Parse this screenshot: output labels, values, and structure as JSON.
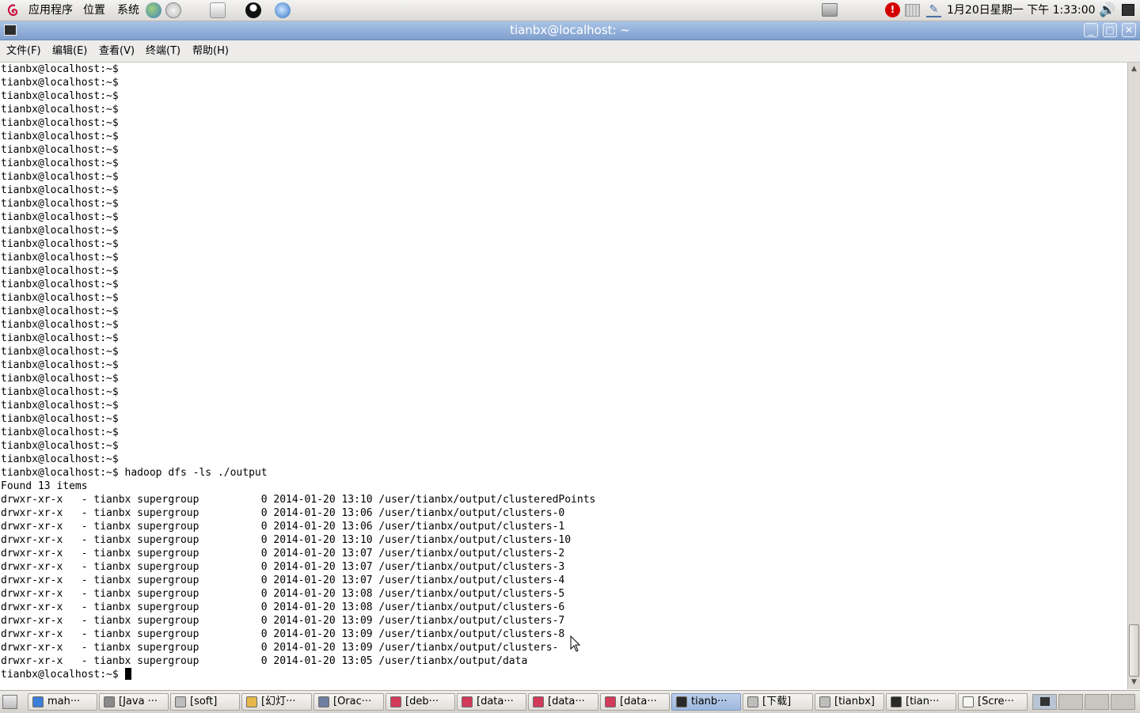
{
  "top_panel": {
    "applications": "应用程序",
    "places": "位置",
    "system": "系统",
    "clock": "1月20日星期一 下午  1:33:00"
  },
  "window": {
    "title": "tianbx@localhost: ~",
    "menus": [
      "文件(F)",
      "编辑(E)",
      "查看(V)",
      "终端(T)",
      "帮助(H)"
    ]
  },
  "terminal": {
    "prompt": "tianbx@localhost:~$",
    "empty_prompt_count": 30,
    "command": "hadoop dfs -ls ./output",
    "found": "Found 13 items",
    "entries": [
      {
        "perm": "drwxr-xr-x",
        "repl": "-",
        "owner": "tianbx",
        "group": "supergroup",
        "size": "0",
        "date": "2014-01-20",
        "time": "13:10",
        "path": "/user/tianbx/output/clusteredPoints"
      },
      {
        "perm": "drwxr-xr-x",
        "repl": "-",
        "owner": "tianbx",
        "group": "supergroup",
        "size": "0",
        "date": "2014-01-20",
        "time": "13:06",
        "path": "/user/tianbx/output/clusters-0"
      },
      {
        "perm": "drwxr-xr-x",
        "repl": "-",
        "owner": "tianbx",
        "group": "supergroup",
        "size": "0",
        "date": "2014-01-20",
        "time": "13:06",
        "path": "/user/tianbx/output/clusters-1"
      },
      {
        "perm": "drwxr-xr-x",
        "repl": "-",
        "owner": "tianbx",
        "group": "supergroup",
        "size": "0",
        "date": "2014-01-20",
        "time": "13:10",
        "path": "/user/tianbx/output/clusters-10"
      },
      {
        "perm": "drwxr-xr-x",
        "repl": "-",
        "owner": "tianbx",
        "group": "supergroup",
        "size": "0",
        "date": "2014-01-20",
        "time": "13:07",
        "path": "/user/tianbx/output/clusters-2"
      },
      {
        "perm": "drwxr-xr-x",
        "repl": "-",
        "owner": "tianbx",
        "group": "supergroup",
        "size": "0",
        "date": "2014-01-20",
        "time": "13:07",
        "path": "/user/tianbx/output/clusters-3"
      },
      {
        "perm": "drwxr-xr-x",
        "repl": "-",
        "owner": "tianbx",
        "group": "supergroup",
        "size": "0",
        "date": "2014-01-20",
        "time": "13:07",
        "path": "/user/tianbx/output/clusters-4"
      },
      {
        "perm": "drwxr-xr-x",
        "repl": "-",
        "owner": "tianbx",
        "group": "supergroup",
        "size": "0",
        "date": "2014-01-20",
        "time": "13:08",
        "path": "/user/tianbx/output/clusters-5"
      },
      {
        "perm": "drwxr-xr-x",
        "repl": "-",
        "owner": "tianbx",
        "group": "supergroup",
        "size": "0",
        "date": "2014-01-20",
        "time": "13:08",
        "path": "/user/tianbx/output/clusters-6"
      },
      {
        "perm": "drwxr-xr-x",
        "repl": "-",
        "owner": "tianbx",
        "group": "supergroup",
        "size": "0",
        "date": "2014-01-20",
        "time": "13:09",
        "path": "/user/tianbx/output/clusters-7"
      },
      {
        "perm": "drwxr-xr-x",
        "repl": "-",
        "owner": "tianbx",
        "group": "supergroup",
        "size": "0",
        "date": "2014-01-20",
        "time": "13:09",
        "path": "/user/tianbx/output/clusters-8"
      },
      {
        "perm": "drwxr-xr-x",
        "repl": "-",
        "owner": "tianbx",
        "group": "supergroup",
        "size": "0",
        "date": "2014-01-20",
        "time": "13:09",
        "path": "/user/tianbx/output/clusters-"
      },
      {
        "perm": "drwxr-xr-x",
        "repl": "-",
        "owner": "tianbx",
        "group": "supergroup",
        "size": "0",
        "date": "2014-01-20",
        "time": "13:05",
        "path": "/user/tianbx/output/data"
      }
    ]
  },
  "taskbar": [
    {
      "label": "mah···",
      "icon": "browser-icon"
    },
    {
      "label": "[Java ···",
      "icon": "gear-icon"
    },
    {
      "label": "[soft]",
      "icon": "folder-icon"
    },
    {
      "label": "[幻灯···",
      "icon": "slides-icon"
    },
    {
      "label": "[Orac···",
      "icon": "vbox-icon"
    },
    {
      "label": "[deb···",
      "icon": "debian-icon"
    },
    {
      "label": "[data···",
      "icon": "debian-icon"
    },
    {
      "label": "[data···",
      "icon": "debian-icon"
    },
    {
      "label": "[data···",
      "icon": "debian-icon"
    },
    {
      "label": "tianb···",
      "icon": "terminal-icon",
      "active": true
    },
    {
      "label": "[下载]",
      "icon": "folder-icon"
    },
    {
      "label": "[tianbx]",
      "icon": "folder-icon"
    },
    {
      "label": "[tian···",
      "icon": "terminal-icon"
    },
    {
      "label": "[Scre···",
      "icon": "screenshot-icon"
    }
  ],
  "colors": {
    "titlebar": "#8fadd8",
    "terminal_bg": "#ffffff",
    "terminal_fg": "#000000"
  }
}
